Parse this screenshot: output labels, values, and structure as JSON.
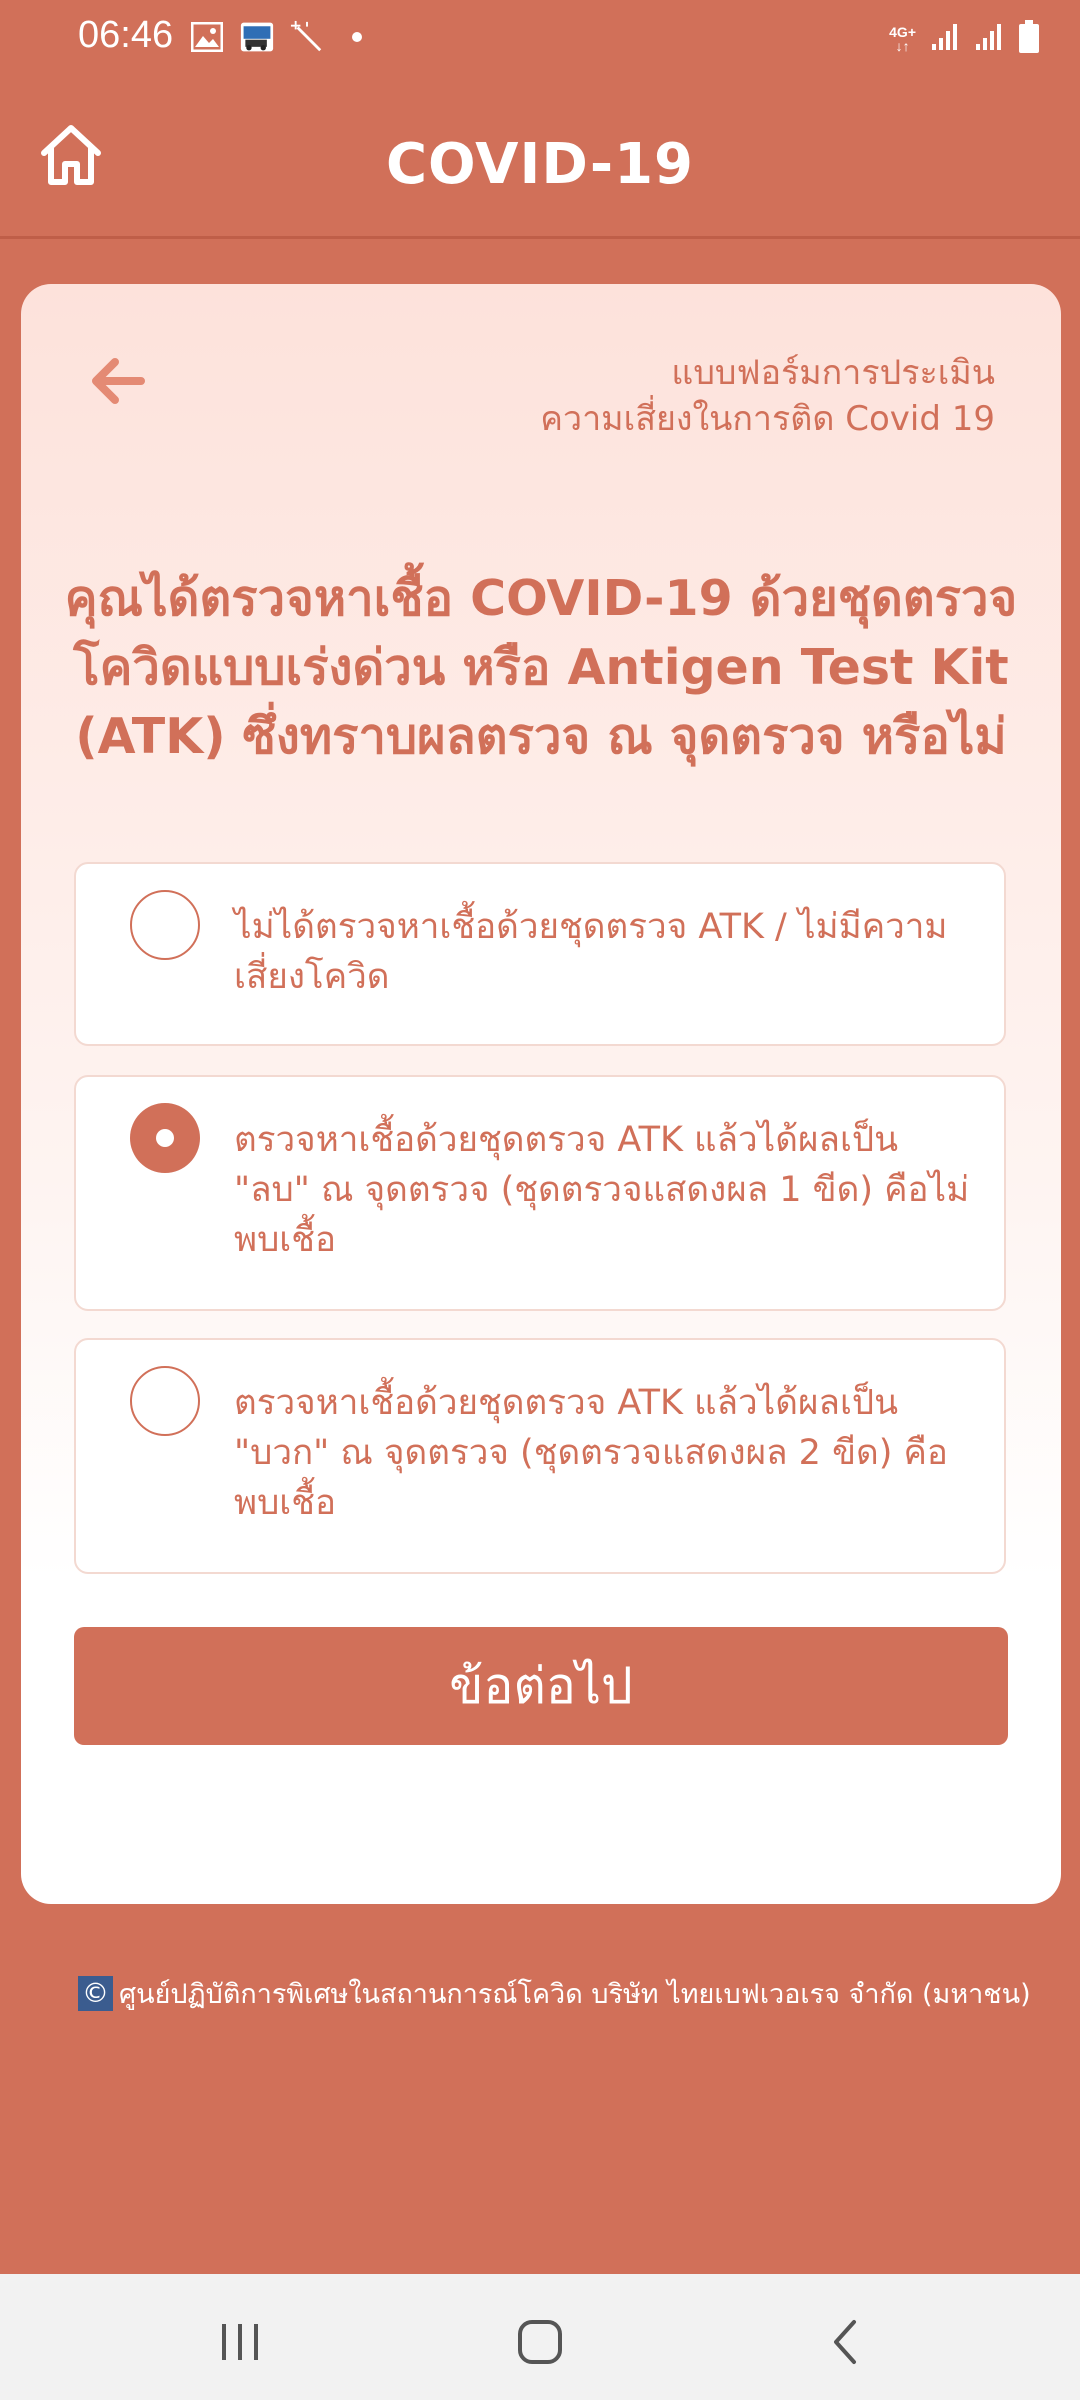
{
  "status_bar": {
    "time": "06:46",
    "network": "4G+",
    "icons": [
      "gallery-icon",
      "app-thumb-icon",
      "magic-wand-icon",
      "dot-icon",
      "signal-icon",
      "signal-icon-2",
      "battery-icon"
    ]
  },
  "app_bar": {
    "title": "COVID-19",
    "home_icon": "home-icon"
  },
  "form": {
    "title_line1": "แบบฟอร์มการประเมิน",
    "title_line2": "ความเสี่ยงในการติด Covid 19",
    "question": "คุณได้ตรวจหาเชื้อ COVID-19 ด้วยชุดตรวจโควิดแบบเร่งด่วน หรือ Antigen Test Kit (ATK) ซึ่งทราบผลตรวจ ณ จุดตรวจ หรือไม่",
    "options": [
      {
        "label": "ไม่ได้ตรวจหาเชื้อด้วยชุดตรวจ ATK / ไม่มีความเสี่ยงโควิด",
        "selected": false
      },
      {
        "label": "ตรวจหาเชื้อด้วยชุดตรวจ ATK แล้วได้ผลเป็น \"ลบ\" ณ จุดตรวจ (ชุดตรวจแสดงผล 1 ขีด) คือไม่พบเชื้อ",
        "selected": true
      },
      {
        "label": "ตรวจหาเชื้อด้วยชุดตรวจ ATK แล้วได้ผลเป็น \"บวก\" ณ จุดตรวจ (ชุดตรวจแสดงผล 2 ขีด) คือ พบเชื้อ",
        "selected": false
      }
    ],
    "next_label": "ข้อต่อไป"
  },
  "footer": {
    "copyright_symbol": "©",
    "text": "ศูนย์ปฏิบัติการพิเศษในสถานการณ์โควิด บริษัท ไทยเบฟเวอเรจ จำกัด (มหาชน)"
  },
  "nav_bar": {
    "icons": [
      "recent-apps-icon",
      "home-nav-icon",
      "back-nav-icon"
    ]
  },
  "colors": {
    "primary": "#D17059",
    "card_top": "#FDE2DB",
    "white": "#FFFFFF"
  }
}
